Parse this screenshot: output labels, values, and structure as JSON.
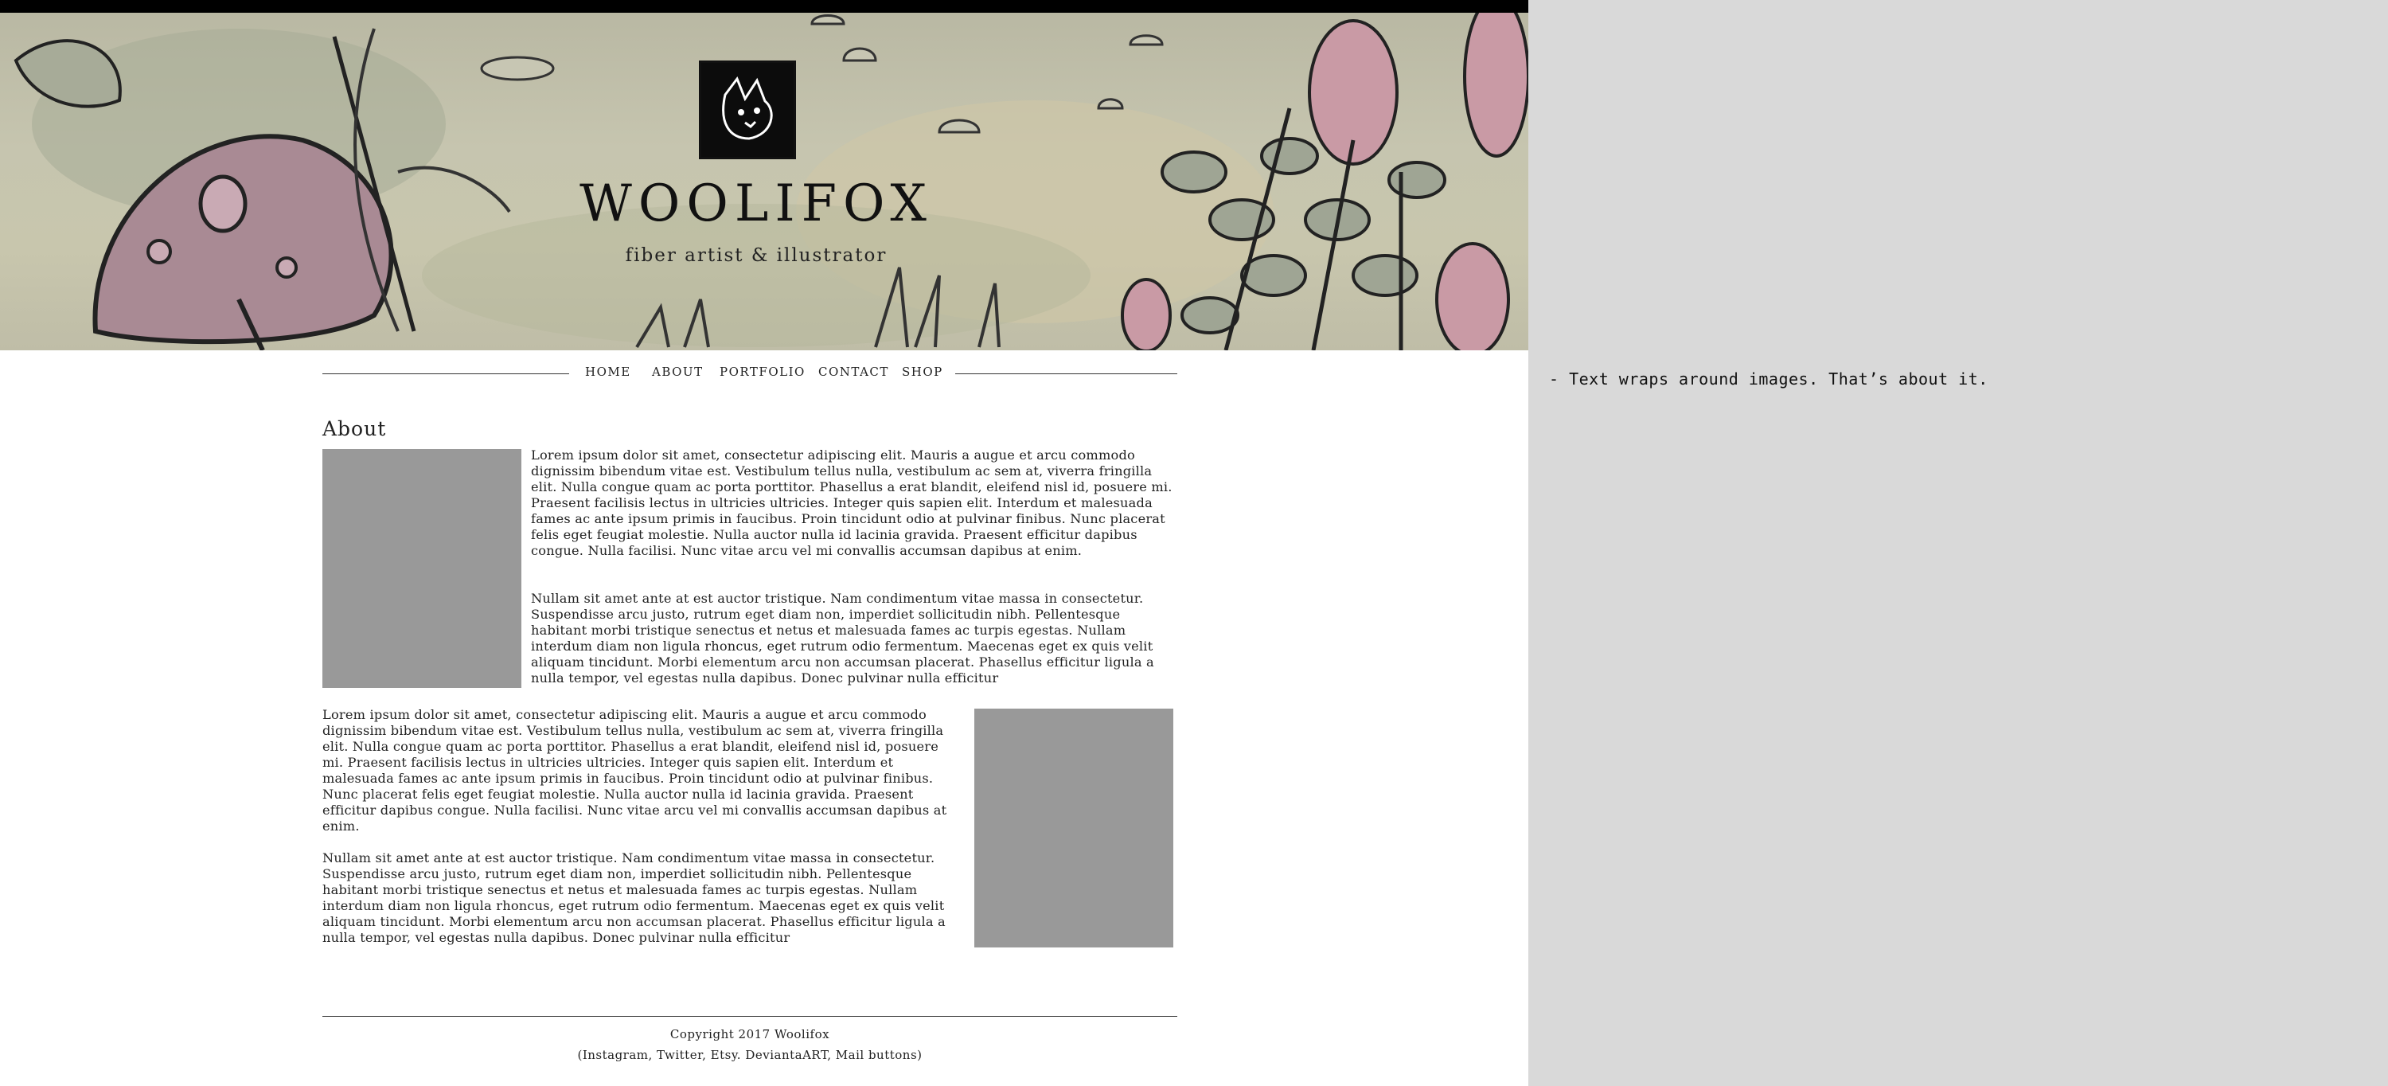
{
  "header": {
    "title": "WOOLIFOX",
    "subtitle": "fiber artist & illustrator",
    "logo_icon": "fox-logo-icon"
  },
  "nav": {
    "items": [
      {
        "label": "HOME"
      },
      {
        "label": "ABOUT"
      },
      {
        "label": "PORTFOLIO"
      },
      {
        "label": "CONTACT"
      },
      {
        "label": "SHOP"
      }
    ]
  },
  "about": {
    "heading": "About",
    "block1": {
      "p1": "Lorem ipsum dolor sit amet, consectetur adipiscing elit. Mauris a augue et arcu commodo dignissim bibendum vitae est. Vestibulum tellus nulla, vestibulum ac sem at, viverra fringilla elit. Nulla congue quam ac porta porttitor. Phasellus a erat blandit, eleifend nisl id, posuere mi. Praesent facilisis lectus in ultricies ultricies. Integer quis sapien elit. Interdum et malesuada fames ac ante ipsum primis in faucibus. Proin tincidunt odio at pulvinar finibus. Nunc placerat felis eget feugiat molestie. Nulla auctor nulla id lacinia gravida. Praesent efficitur dapibus congue. Nulla facilisi. Nunc vitae arcu vel mi convallis accumsan dapibus at enim.",
      "p2": "Nullam sit amet ante at est auctor tristique. Nam condimentum vitae massa in consectetur. Suspendisse arcu justo, rutrum eget diam non, imperdiet sollicitudin nibh. Pellentesque habitant morbi tristique senectus et netus et malesuada fames ac turpis egestas. Nullam interdum diam non ligula rhoncus, eget rutrum odio fermentum. Maecenas eget ex quis velit aliquam tincidunt. Morbi elementum arcu non accumsan placerat. Phasellus efficitur ligula a nulla tempor, vel egestas nulla dapibus. Donec pulvinar nulla efficitur"
    },
    "block2": {
      "p1": "Lorem ipsum dolor sit amet, consectetur adipiscing elit. Mauris a augue et arcu commodo dignissim bibendum vitae est. Vestibulum tellus nulla, vestibulum ac sem at, viverra fringilla elit. Nulla congue quam ac porta porttitor. Phasellus a erat blandit, eleifend nisl id, posuere mi. Praesent facilisis lectus in ultricies ultricies. Integer quis sapien elit. Interdum et malesuada fames ac ante ipsum primis in faucibus. Proin tincidunt odio at pulvinar finibus. Nunc placerat felis eget feugiat molestie. Nulla auctor nulla id lacinia gravida. Praesent efficitur dapibus congue. Nulla facilisi. Nunc vitae arcu vel mi convallis accumsan dapibus at enim.",
      "p2": "Nullam sit amet ante at est auctor tristique. Nam condimentum vitae massa in consectetur. Suspendisse arcu justo, rutrum eget diam non, imperdiet sollicitudin nibh. Pellentesque habitant morbi tristique senectus et netus et malesuada fames ac turpis egestas. Nullam interdum diam non ligula rhoncus, eget rutrum odio fermentum. Maecenas eget ex quis velit aliquam tincidunt. Morbi elementum arcu non accumsan placerat. Phasellus efficitur ligula a nulla tempor, vel egestas nulla dapibus. Donec pulvinar nulla efficitur"
    }
  },
  "footer": {
    "copyright": "Copyright 2017 Woolifox",
    "social": "(Instagram, Twitter, Etsy. DeviantaART, Mail buttons)"
  },
  "side_note": "- Text wraps around images. That’s about it.",
  "colors": {
    "placeholder_gray": "#999999",
    "side_panel": "#d9d9d9"
  }
}
